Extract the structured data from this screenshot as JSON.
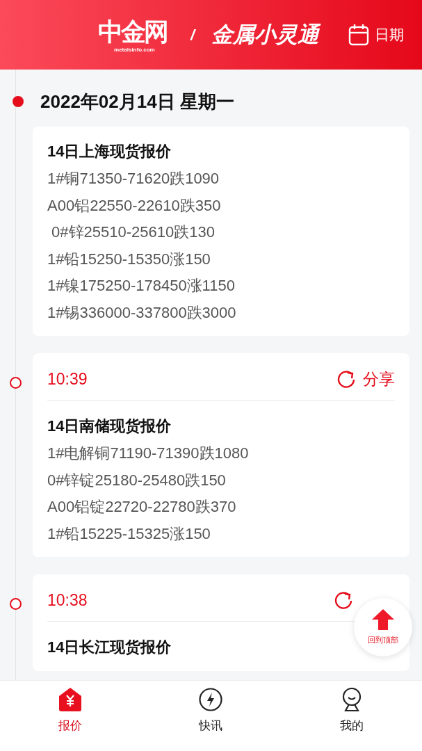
{
  "header": {
    "logo": "中金网",
    "logo_sub": "metalsinfo.com",
    "separator": "/",
    "app_name": "金属小灵通",
    "date_button": "日期"
  },
  "date_heading": "2022年02月14日 星期一",
  "entries": [
    {
      "title": "14日上海现货报价",
      "lines": [
        "1#铜71350-71620跌1090",
        "A00铝22550-22610跌350",
        " 0#锌25510-25610跌130",
        "1#铅15250-15350涨150",
        "1#镍175250-178450涨1150",
        "1#锡336000-337800跌3000"
      ]
    },
    {
      "time": "10:39",
      "share_button": true,
      "share": "分享",
      "title": "14日南储现货报价",
      "lines": [
        "1#电解铜71190-71390跌1080",
        "0#锌锭25180-25480跌150",
        "A00铝锭22720-22780跌370",
        "1#铅15225-15325涨150"
      ]
    },
    {
      "time": "10:38",
      "share_button": true,
      "title": "14日长江现货报价"
    }
  ],
  "back_to_top": "回到顶部",
  "tabs": [
    {
      "label": "报价",
      "kind": "price",
      "selected": true
    },
    {
      "label": "快讯",
      "kind": "flash",
      "selected": false
    },
    {
      "label": "我的",
      "kind": "me",
      "selected": false
    }
  ]
}
